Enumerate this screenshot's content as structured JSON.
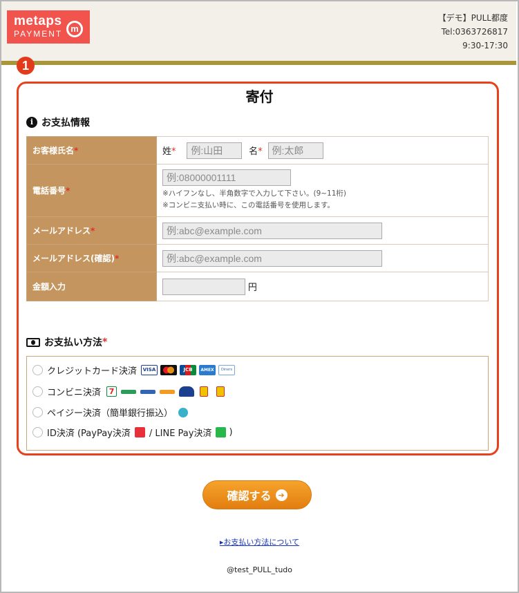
{
  "header": {
    "logo_line1": "metaps",
    "logo_line2": "PAYMENT",
    "logo_mark": "m",
    "shop_name": "【デモ】PULL都度",
    "tel": "Tel:0363726817",
    "hours": "9:30-17:30"
  },
  "marker": "1",
  "page_title": "寄付",
  "payment_info": {
    "section_title": "お支払情報",
    "name_label": "お客様氏名",
    "last_name_label": "姓",
    "last_name_placeholder": "例:山田",
    "first_name_label": "名",
    "first_name_placeholder": "例:太郎",
    "phone_label": "電話番号",
    "phone_placeholder": "例:08000001111",
    "phone_note1": "※ハイフンなし、半角数字で入力して下さい。(9~11桁)",
    "phone_note2": "※コンビニ支払い時に、この電話番号を使用します。",
    "email_label": "メールアドレス",
    "email_placeholder": "例:abc@example.com",
    "email_confirm_label": "メールアドレス(確認)",
    "email_confirm_placeholder": "例:abc@example.com",
    "amount_label": "金額入力",
    "amount_value": "",
    "yen": "円",
    "required_mark": "*"
  },
  "payment_method": {
    "section_title": "お支払い方法",
    "options": [
      {
        "label": "クレジットカード決済"
      },
      {
        "label": "コンビニ決済"
      },
      {
        "label": "ペイジー決済（簡単銀行振込）"
      },
      {
        "label": "ID決済 (PayPay決済",
        "label_mid": " / LINE Pay決済",
        "label_end": ")"
      }
    ],
    "icons": {
      "visa": "VISA",
      "jcb": "JCB",
      "amex": "AMEX",
      "diners": "Diners"
    }
  },
  "confirm_button": "確認する",
  "payment_link": "▸お支払い方法について",
  "footer": "@test_PULL_tudo",
  "colors": {
    "label_bg": "#c4955e",
    "accent_red": "#e8401c",
    "button_orange": "#f39a22",
    "gold_bar": "#a9963a"
  }
}
